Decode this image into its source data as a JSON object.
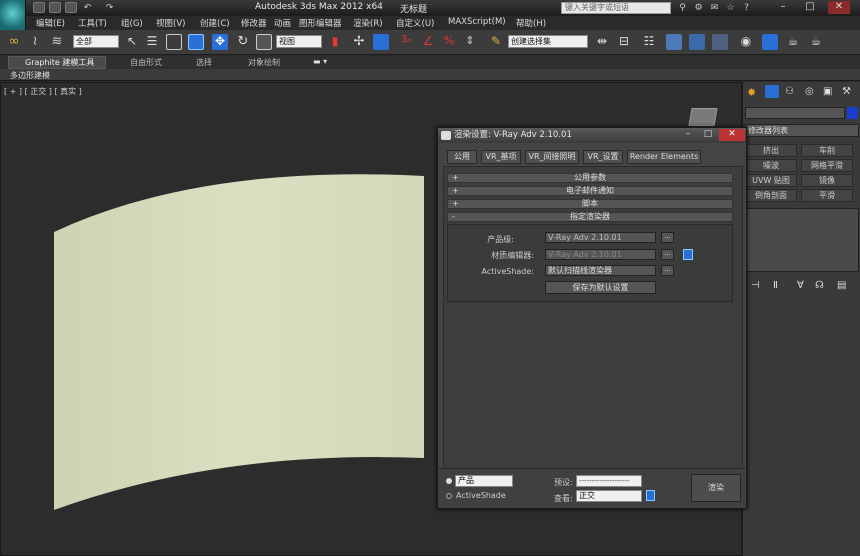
{
  "app": {
    "title": "Autodesk 3ds Max  2012 x64",
    "file": "无标题"
  },
  "search": {
    "placeholder": "键入关键字或短语"
  },
  "menu": [
    "编辑(E)",
    "工具(T)",
    "组(G)",
    "视图(V)",
    "创建(C)",
    "修改器",
    "动画",
    "图形编辑器",
    "渲染(R)",
    "自定义(U)",
    "MAXScript(M)",
    "帮助(H)"
  ],
  "toolbar": {
    "selection_filter": "全部",
    "ref_coord": "视图",
    "named_selection": "创建选择集"
  },
  "ribbon": {
    "tabs": [
      "Graphite 建模工具",
      "自由形式",
      "选择",
      "对象绘制"
    ],
    "sub_label": "多边形建模"
  },
  "viewport": {
    "label": "[ + ] [ 正交 ] [ 真实 ]"
  },
  "command_panel": {
    "modifier_list": "修改器列表",
    "buttons": [
      "挤出",
      "车削",
      "噪波",
      "网格平滑",
      "UVW 贴图",
      "镜像",
      "倒角剖面",
      "平滑"
    ]
  },
  "render_dialog": {
    "title": "渲染设置: V-Ray Adv 2.10.01",
    "tabs": [
      "公用",
      "VR_基项",
      "VR_间接照明",
      "VR_设置",
      "Render Elements"
    ],
    "rollouts": [
      {
        "sign": "+",
        "label": "公用参数"
      },
      {
        "sign": "+",
        "label": "电子邮件通知"
      },
      {
        "sign": "+",
        "label": "脚本"
      },
      {
        "sign": "-",
        "label": "指定渲染器"
      }
    ],
    "assign": {
      "production_label": "产品级:",
      "production_value": "V-Ray Adv 2.10.01",
      "material_editor_label": "材质编辑器:",
      "material_editor_value": "V-Ray Adv 2.10.01",
      "activeshade_label": "ActiveShade:",
      "activeshade_value": "默认扫描线渲染器",
      "save_default_label": "保存为默认设置",
      "dots": "..."
    },
    "bottom": {
      "mode_product": "产品",
      "mode_activeshade": "ActiveShade",
      "preset_label": "预设:",
      "preset_value": "--------------------",
      "view_label": "查看:",
      "view_value": "正交",
      "render_label": "渲染"
    }
  },
  "colors": {
    "surface": "#d6dcbd",
    "viewport_bg": "#2c2c2c",
    "accent_blue": "#2a6fd6"
  }
}
